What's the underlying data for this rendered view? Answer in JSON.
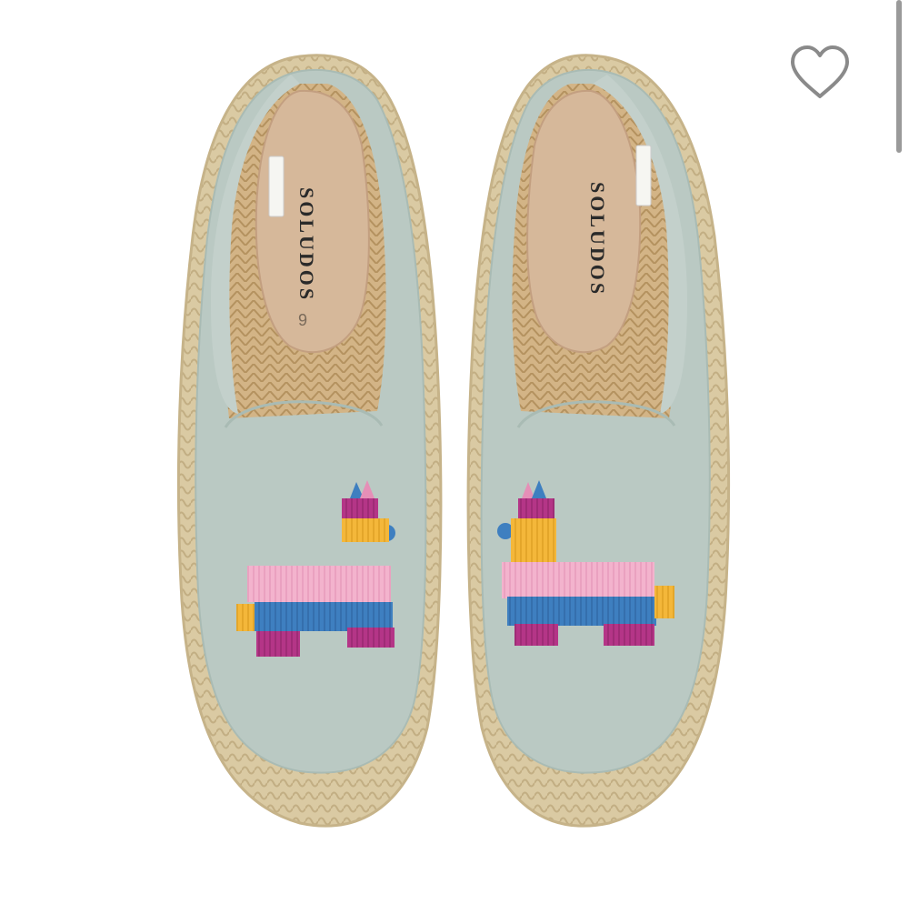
{
  "product": {
    "brand_left": "SOLUDOS",
    "brand_right": "SOLUDOS",
    "size_mark": "9",
    "image_alt": "Espadrille slip-on shoes with piñata embroidery"
  },
  "actions": {
    "favorite_icon": "heart-outline-icon"
  },
  "colors": {
    "canvas": "#b9c9c3",
    "jute": "#d9c9a3",
    "insole": "#d8b99a",
    "pink": "#f0a9c6",
    "blue": "#3f7fbf",
    "magenta": "#b0317f",
    "yellow": "#f2b632"
  }
}
